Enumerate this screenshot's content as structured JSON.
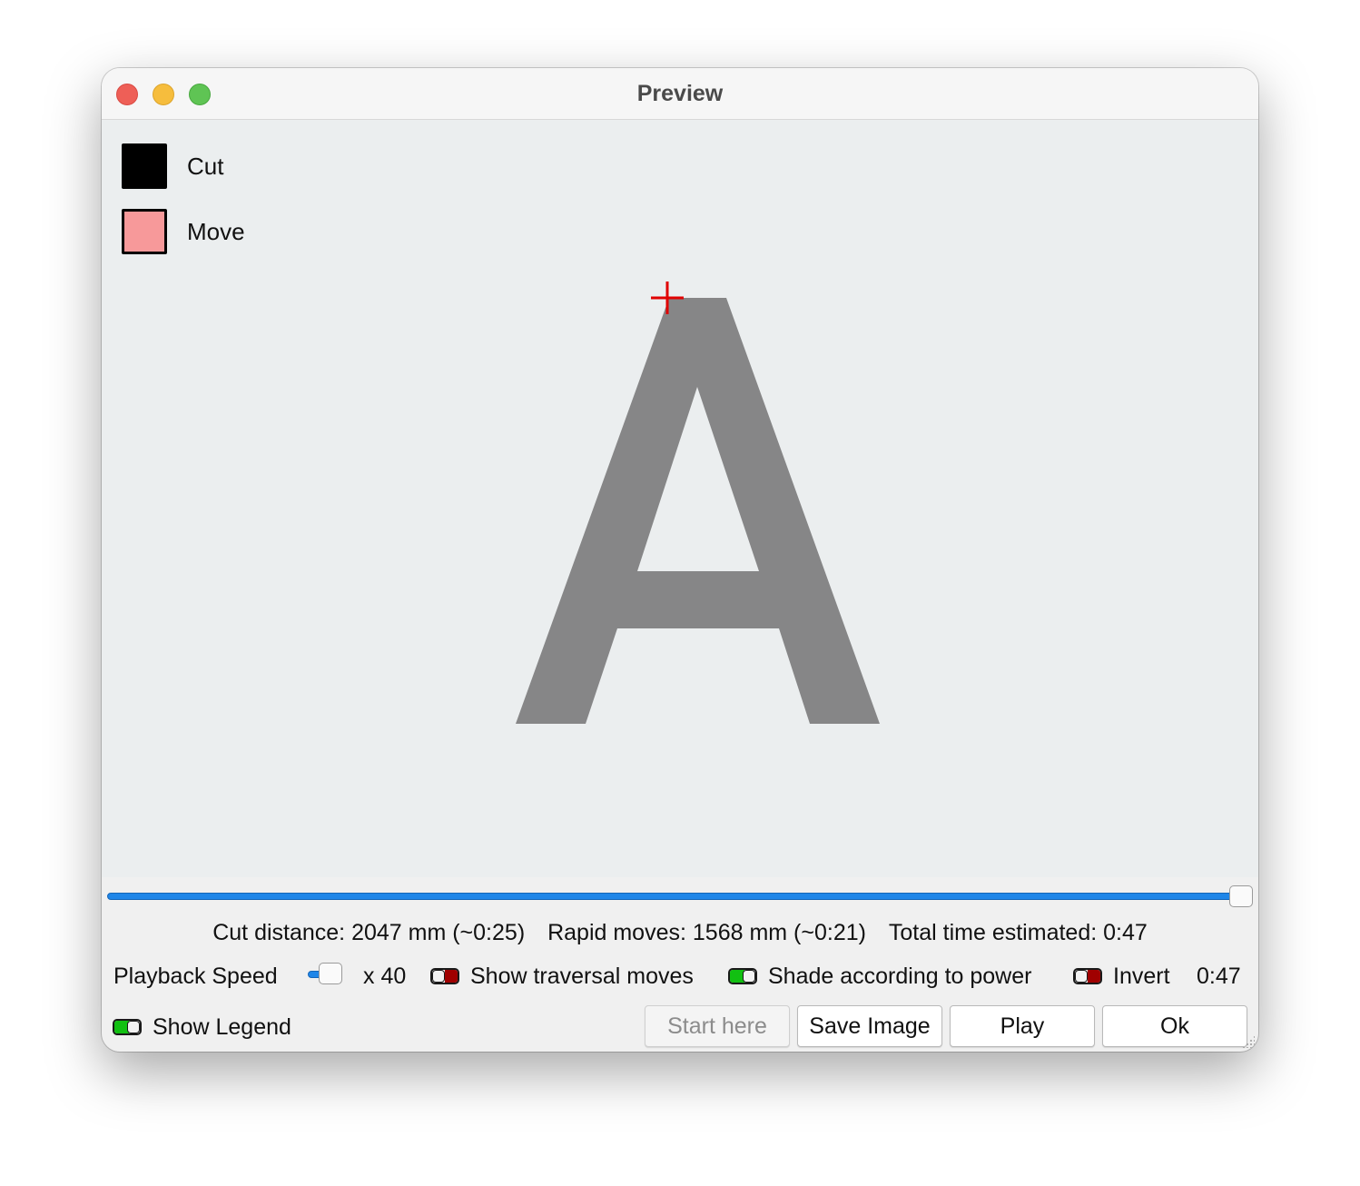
{
  "window": {
    "title": "Preview"
  },
  "legend": [
    {
      "label": "Cut",
      "color": "#000000"
    },
    {
      "label": "Move",
      "color": "#f7999a"
    }
  ],
  "canvas": {
    "glyph": "A",
    "glyph_color": "#868687",
    "marker_color": "#e00000",
    "background": "#ebeeef"
  },
  "progress": {
    "value": 1.0
  },
  "stats": {
    "cut_distance": "Cut distance: 2047 mm (~0:25)",
    "rapid_moves": "Rapid moves: 1568 mm (~0:21)",
    "total_time": "Total time estimated: 0:47"
  },
  "controls": {
    "playback_speed_label": "Playback Speed",
    "playback_speed_value": "x 40",
    "show_traversal_label": "Show traversal moves",
    "show_traversal_on": false,
    "shade_power_label": "Shade according to power",
    "shade_power_on": true,
    "invert_label": "Invert",
    "invert_on": false,
    "time_readout": "0:47",
    "show_legend_label": "Show Legend",
    "show_legend_on": true
  },
  "buttons": {
    "start_here": "Start here",
    "save_image": "Save Image",
    "play": "Play",
    "ok": "Ok"
  }
}
